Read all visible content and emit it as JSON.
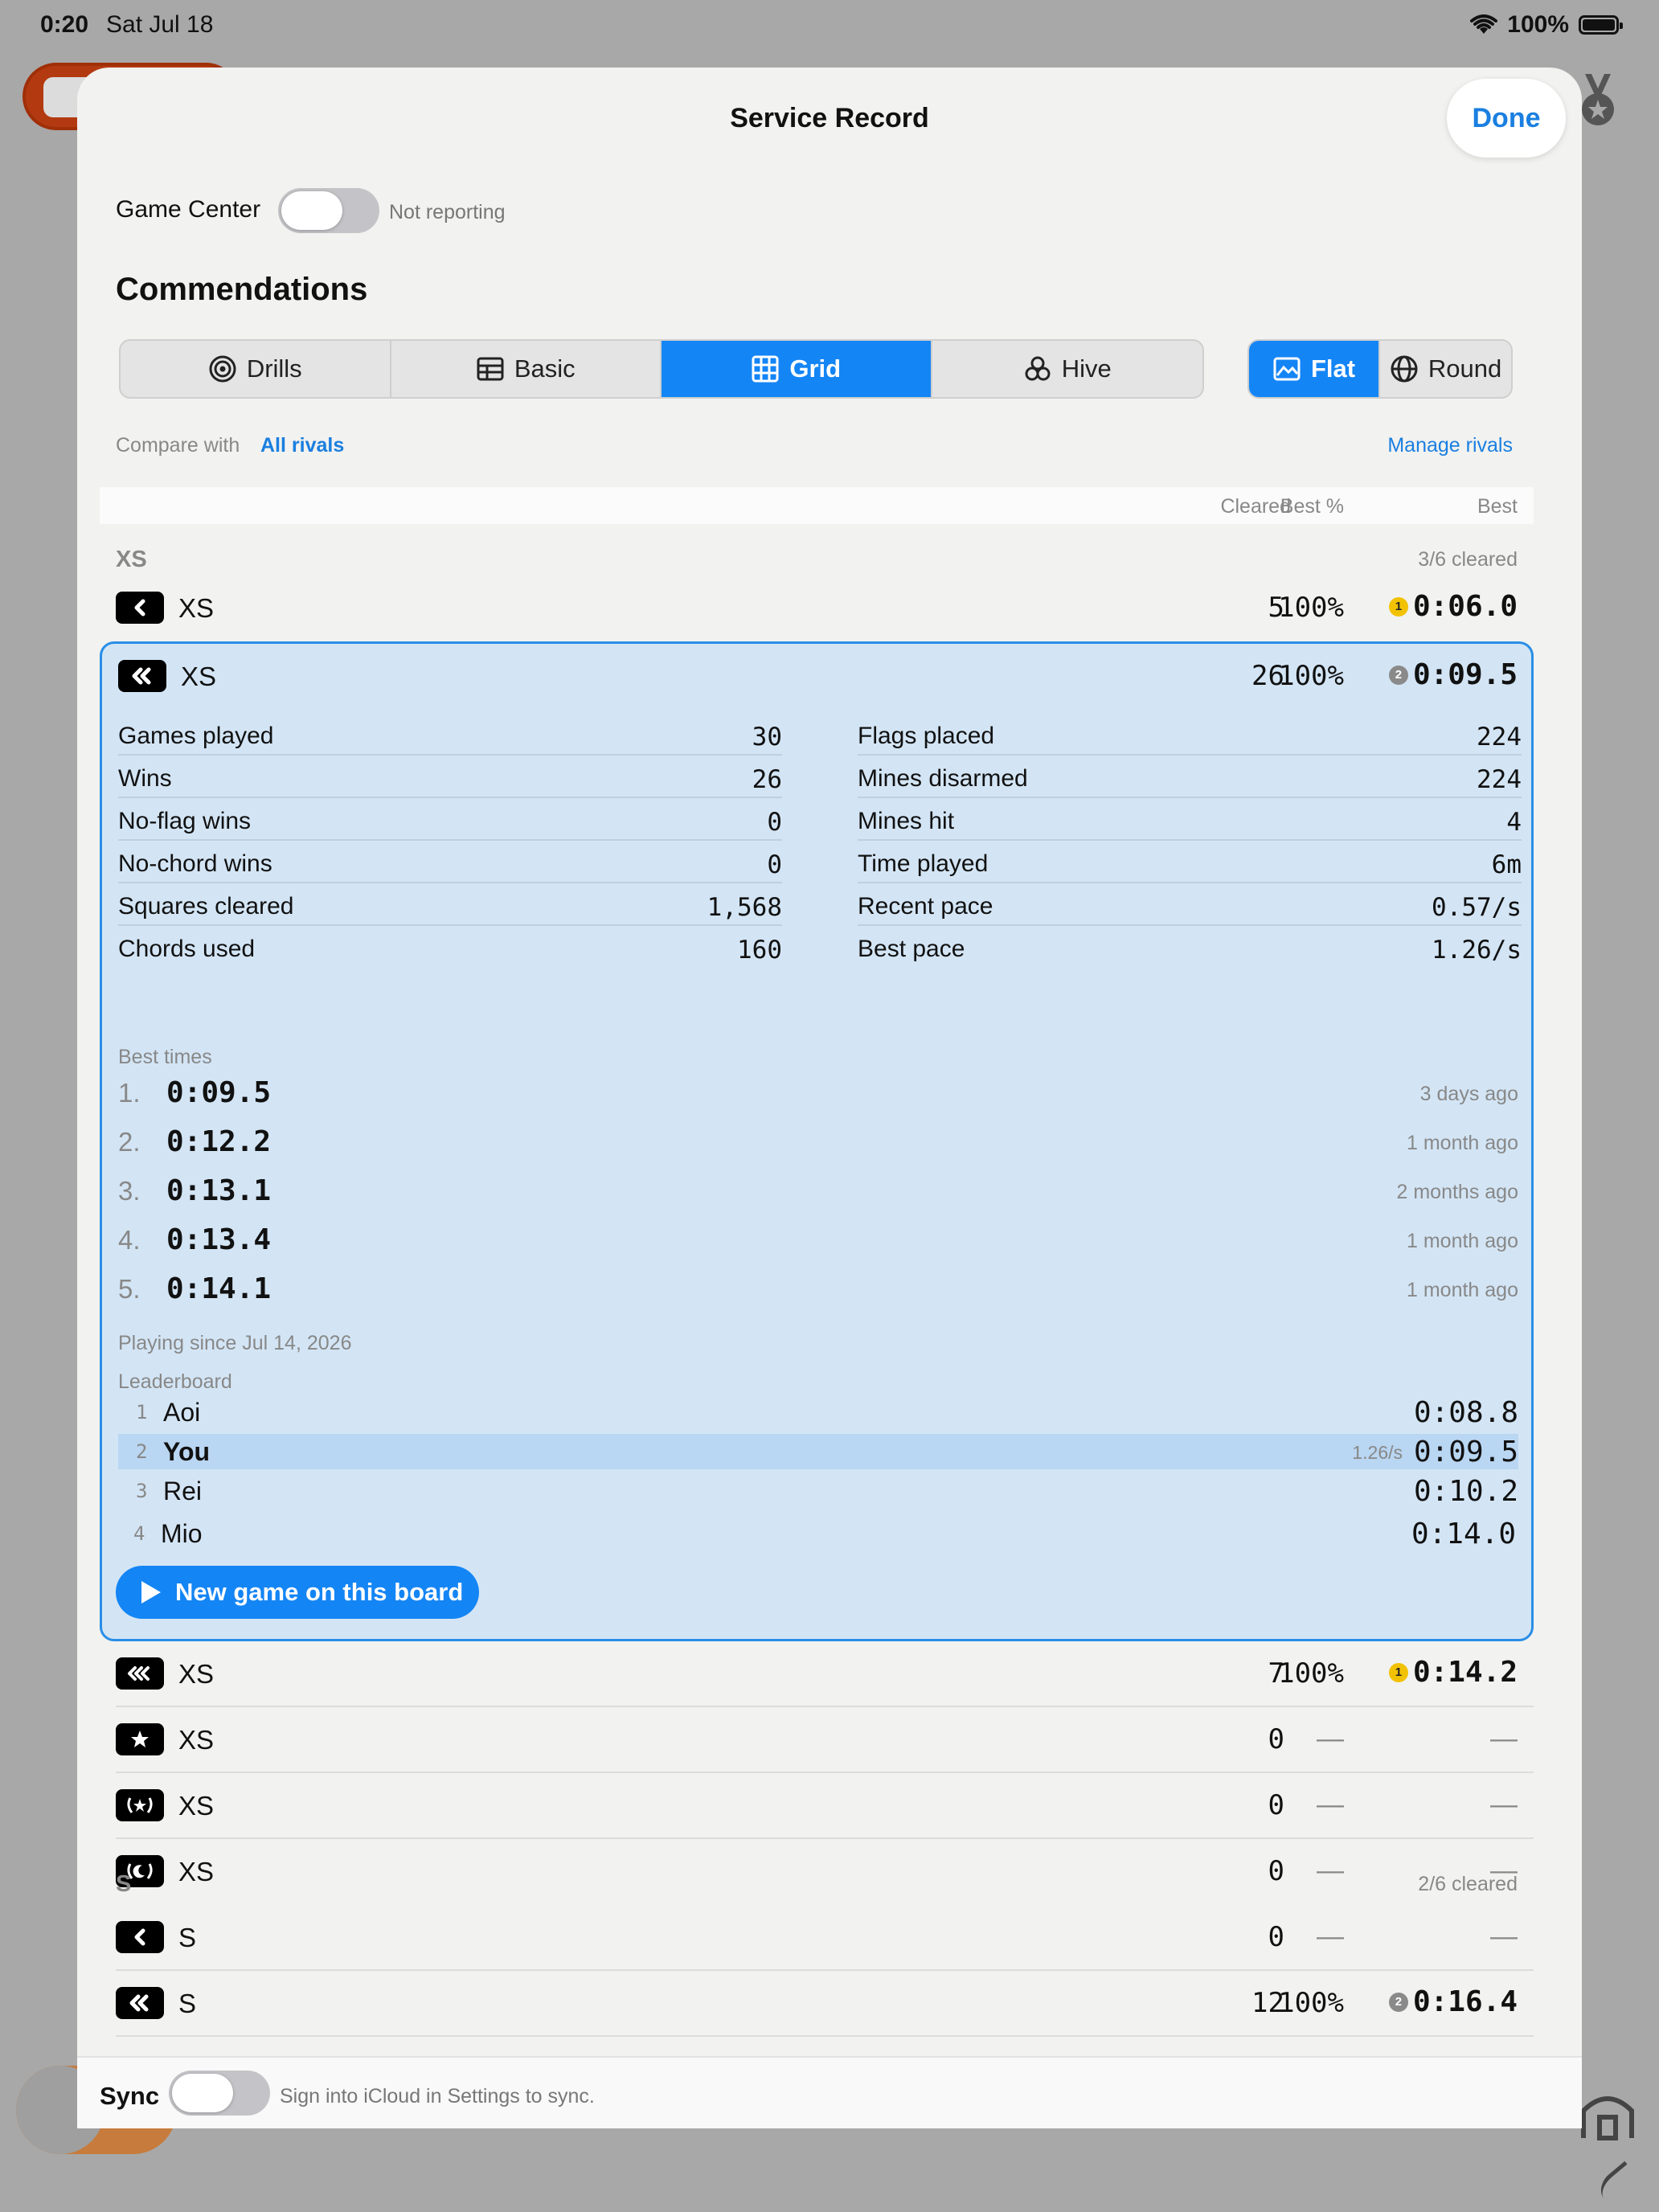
{
  "status_bar": {
    "time": "0:20",
    "date": "Sat Jul 18",
    "battery": "100%"
  },
  "sheet": {
    "title": "Service Record",
    "done_label": "Done"
  },
  "game_center": {
    "label": "Game Center",
    "status": "Not reporting",
    "enabled": false
  },
  "section_title": "Commendations",
  "mode_tabs": [
    {
      "label": "Drills",
      "icon": "target-icon",
      "active": false
    },
    {
      "label": "Basic",
      "icon": "table-icon",
      "active": false
    },
    {
      "label": "Grid",
      "icon": "grid-icon",
      "active": true
    },
    {
      "label": "Hive",
      "icon": "hive-icon",
      "active": false
    }
  ],
  "shape_tabs": [
    {
      "label": "Flat",
      "icon": "image-icon",
      "active": true
    },
    {
      "label": "Round",
      "icon": "globe-icon",
      "active": false
    }
  ],
  "compare": {
    "label": "Compare with",
    "value": "All rivals",
    "manage_label": "Manage rivals"
  },
  "columns": {
    "cleared": "Cleared",
    "best_pct": "Best %",
    "best": "Best"
  },
  "groups": {
    "xs": {
      "label": "XS",
      "cleared": "3/6 cleared"
    },
    "s": {
      "label": "S",
      "cleared": "2/6 cleared"
    }
  },
  "rows": [
    {
      "name": "XS",
      "badge": "chevron-single-icon",
      "cleared": "5",
      "pct": "100%",
      "best": "0:06.0",
      "medal": "1",
      "medal_color": "gold"
    },
    {
      "name": "XS",
      "badge": "chevron-double-icon",
      "cleared": "26",
      "pct": "100%",
      "best": "0:09.5",
      "medal": "2",
      "medal_color": "silver"
    },
    {
      "name": "XS",
      "badge": "chevron-triple-icon",
      "cleared": "7",
      "pct": "100%",
      "best": "0:14.2",
      "medal": "1",
      "medal_color": "gold"
    },
    {
      "name": "XS",
      "badge": "star-icon",
      "cleared": "0",
      "pct": "—",
      "best": "—"
    },
    {
      "name": "XS",
      "badge": "laurel-star-icon",
      "cleared": "0",
      "pct": "—",
      "best": "—"
    },
    {
      "name": "XS",
      "badge": "laurel-moon-icon",
      "cleared": "0",
      "pct": "—",
      "best": "—"
    },
    {
      "name": "S",
      "badge": "chevron-single-icon",
      "cleared": "0",
      "pct": "—",
      "best": "—"
    },
    {
      "name": "S",
      "badge": "chevron-double-icon",
      "cleared": "12",
      "pct": "100%",
      "best": "0:16.4",
      "medal": "2",
      "medal_color": "silver"
    }
  ],
  "details": {
    "left": [
      {
        "k": "Games played",
        "v": "30"
      },
      {
        "k": "Wins",
        "v": "26"
      },
      {
        "k": "No-flag wins",
        "v": "0"
      },
      {
        "k": "No-chord wins",
        "v": "0"
      },
      {
        "k": "Squares cleared",
        "v": "1,568"
      },
      {
        "k": "Chords used",
        "v": "160"
      }
    ],
    "right": [
      {
        "k": "Flags placed",
        "v": "224"
      },
      {
        "k": "Mines disarmed",
        "v": "224"
      },
      {
        "k": "Mines hit",
        "v": "4"
      },
      {
        "k": "Time played",
        "v": "6m"
      },
      {
        "k": "Recent pace",
        "v": "0.57/s"
      },
      {
        "k": "Best pace",
        "v": "1.26/s"
      }
    ],
    "best_times_label": "Best times",
    "best_times": [
      {
        "n": "1.",
        "t": "0:09.5",
        "ago": "3 days ago"
      },
      {
        "n": "2.",
        "t": "0:12.2",
        "ago": "1 month ago"
      },
      {
        "n": "3.",
        "t": "0:13.1",
        "ago": "2 months ago"
      },
      {
        "n": "4.",
        "t": "0:13.4",
        "ago": "1 month ago"
      },
      {
        "n": "5.",
        "t": "0:14.1",
        "ago": "1 month ago"
      }
    ],
    "playing_since": "Playing since Jul 14, 2026",
    "leaderboard_label": "Leaderboard",
    "leaderboard": [
      {
        "rank": "1",
        "who": "Aoi",
        "pace": "",
        "time": "0:08.8"
      },
      {
        "rank": "2",
        "who": "You",
        "pace": "1.26/s",
        "time": "0:09.5",
        "me": true
      },
      {
        "rank": "3",
        "who": "Rei",
        "pace": "",
        "time": "0:10.2"
      },
      {
        "rank": "4",
        "who": "Mio",
        "pace": "",
        "time": "0:14.0"
      }
    ],
    "new_game_label": "New game on this board"
  },
  "sync": {
    "label": "Sync",
    "status": "Sign into iCloud in Settings to sync.",
    "enabled": false
  },
  "colors": {
    "accent": "#1485f5",
    "card_bg": "#d3e5f5",
    "gold": "#f2c200",
    "silver": "#8a8a8a"
  }
}
